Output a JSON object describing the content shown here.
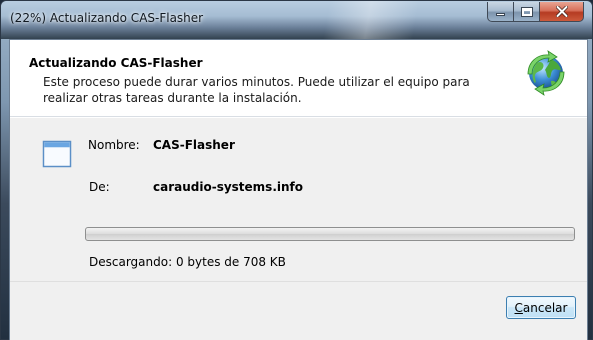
{
  "window": {
    "title": "(22%) Actualizando CAS-Flasher"
  },
  "header": {
    "title": "Actualizando CAS-Flasher",
    "description": "Este proceso puede durar varios minutos. Puede utilizar el equipo para realizar otras tareas durante la instalación."
  },
  "details": {
    "name_label": "Nombre:",
    "name_value": "CAS-Flasher",
    "from_label": "De:",
    "from_value": "caraudio-systems.info"
  },
  "progress": {
    "percent": 0,
    "status_text": "Descargando: 0 bytes de 708 KB"
  },
  "footer": {
    "cancel_accel": "C",
    "cancel_rest": "ancelar"
  },
  "colors": {
    "button_border": "#3c7fb1",
    "header_bg": "#ffffff",
    "body_bg": "#f0f0f0"
  },
  "icons": [
    "window-minimize-icon",
    "window-maximize-icon",
    "window-close-icon",
    "globe-update-icon",
    "application-window-icon"
  ]
}
